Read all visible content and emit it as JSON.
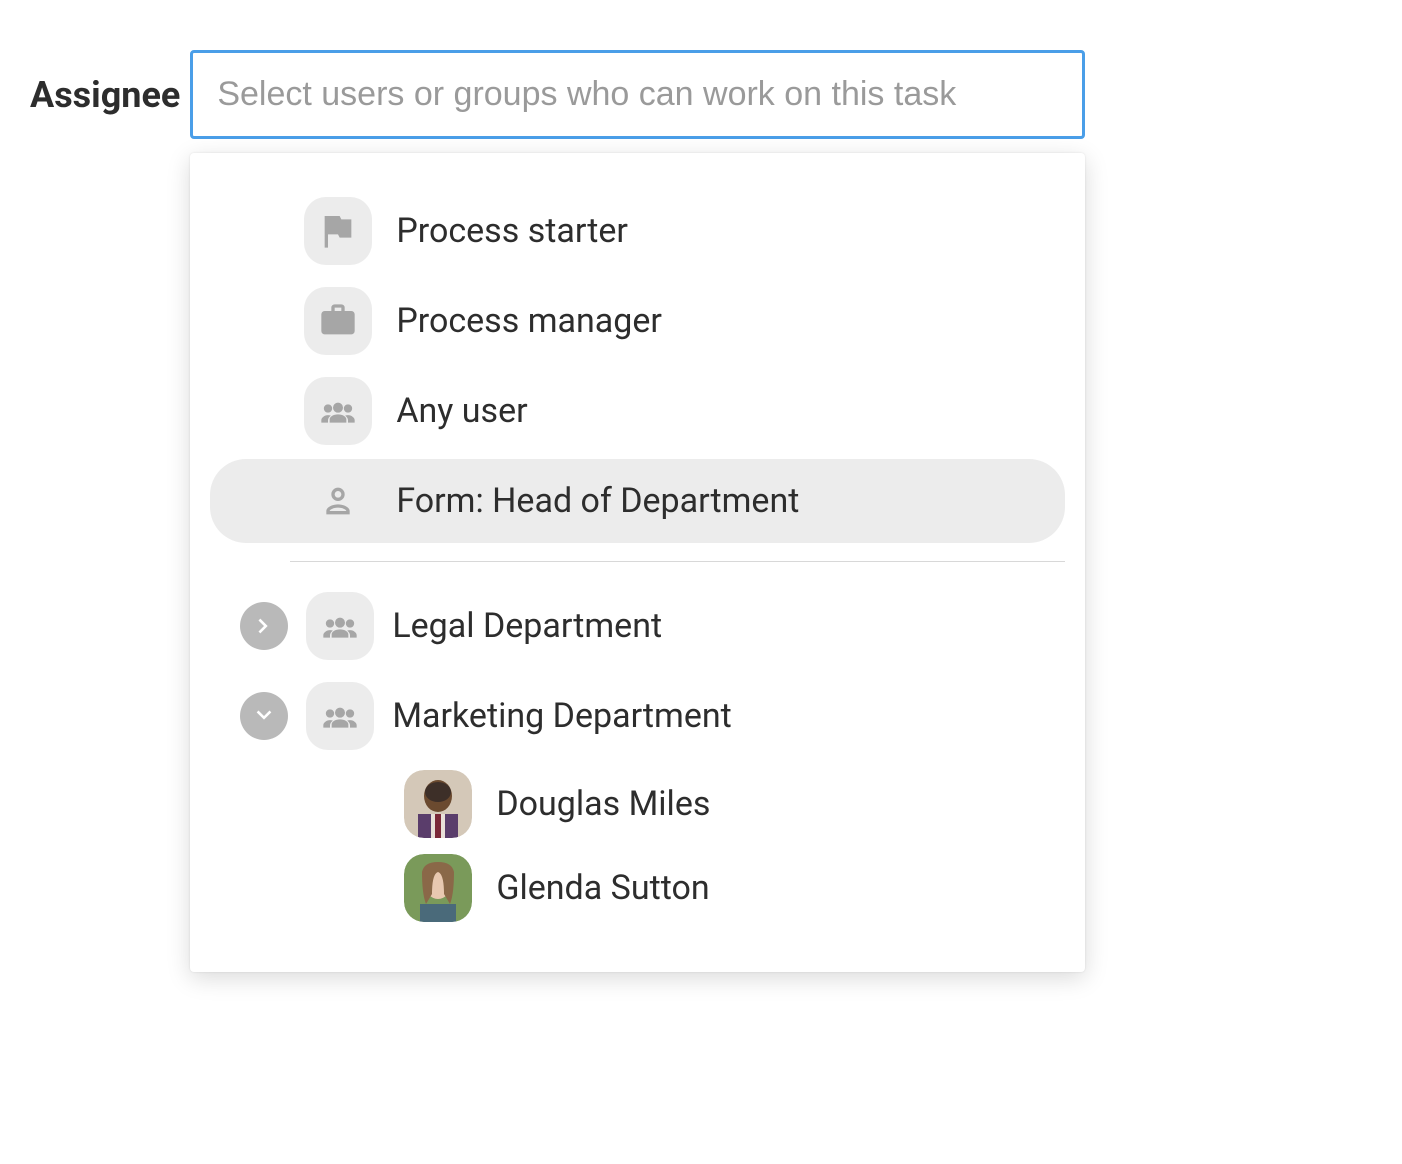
{
  "field": {
    "label": "Assignee",
    "placeholder": "Select users or groups who can work on this task"
  },
  "options": {
    "process_starter": "Process starter",
    "process_manager": "Process manager",
    "any_user": "Any user",
    "form_head": "Form: Head of Department"
  },
  "groups": {
    "legal": "Legal Department",
    "marketing": "Marketing Department"
  },
  "users": {
    "douglas": "Douglas Miles",
    "glenda": "Glenda Sutton"
  }
}
